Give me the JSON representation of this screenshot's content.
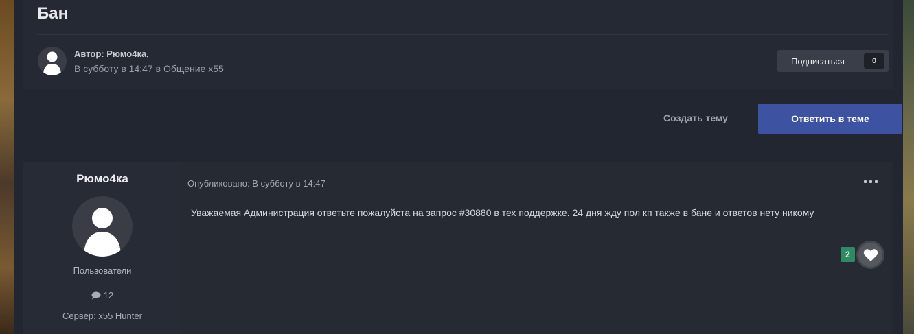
{
  "topic": {
    "title": "Бан",
    "author_line": "Автор: Рюмо4ка,",
    "date_line": "В субботу в 14:47 в Общение x55"
  },
  "subscribe": {
    "label": "Подписаться",
    "count": "0"
  },
  "actions": {
    "create_topic": "Создать тему",
    "reply": "Ответить в теме"
  },
  "post": {
    "author": {
      "name": "Рюмо4ка",
      "group": "Пользователи",
      "posts_count": "12",
      "server": "Сервер: x55 Hunter"
    },
    "published": "Опубликовано: В субботу в 14:47",
    "text": "Уважаемая Администрация ответьте пожалуйста на запрос #30880 в тех поддержке. 24 дня жду пол кп также в бане и ответов нету никому",
    "likes": "2"
  },
  "colors": {
    "accent": "#3d52a0",
    "like_badge": "#2f8a63",
    "background": "#222631"
  },
  "icons": {
    "avatar": "user-silhouette-icon",
    "posts": "comment-icon",
    "menu": "more-icon",
    "like": "heart-icon"
  }
}
